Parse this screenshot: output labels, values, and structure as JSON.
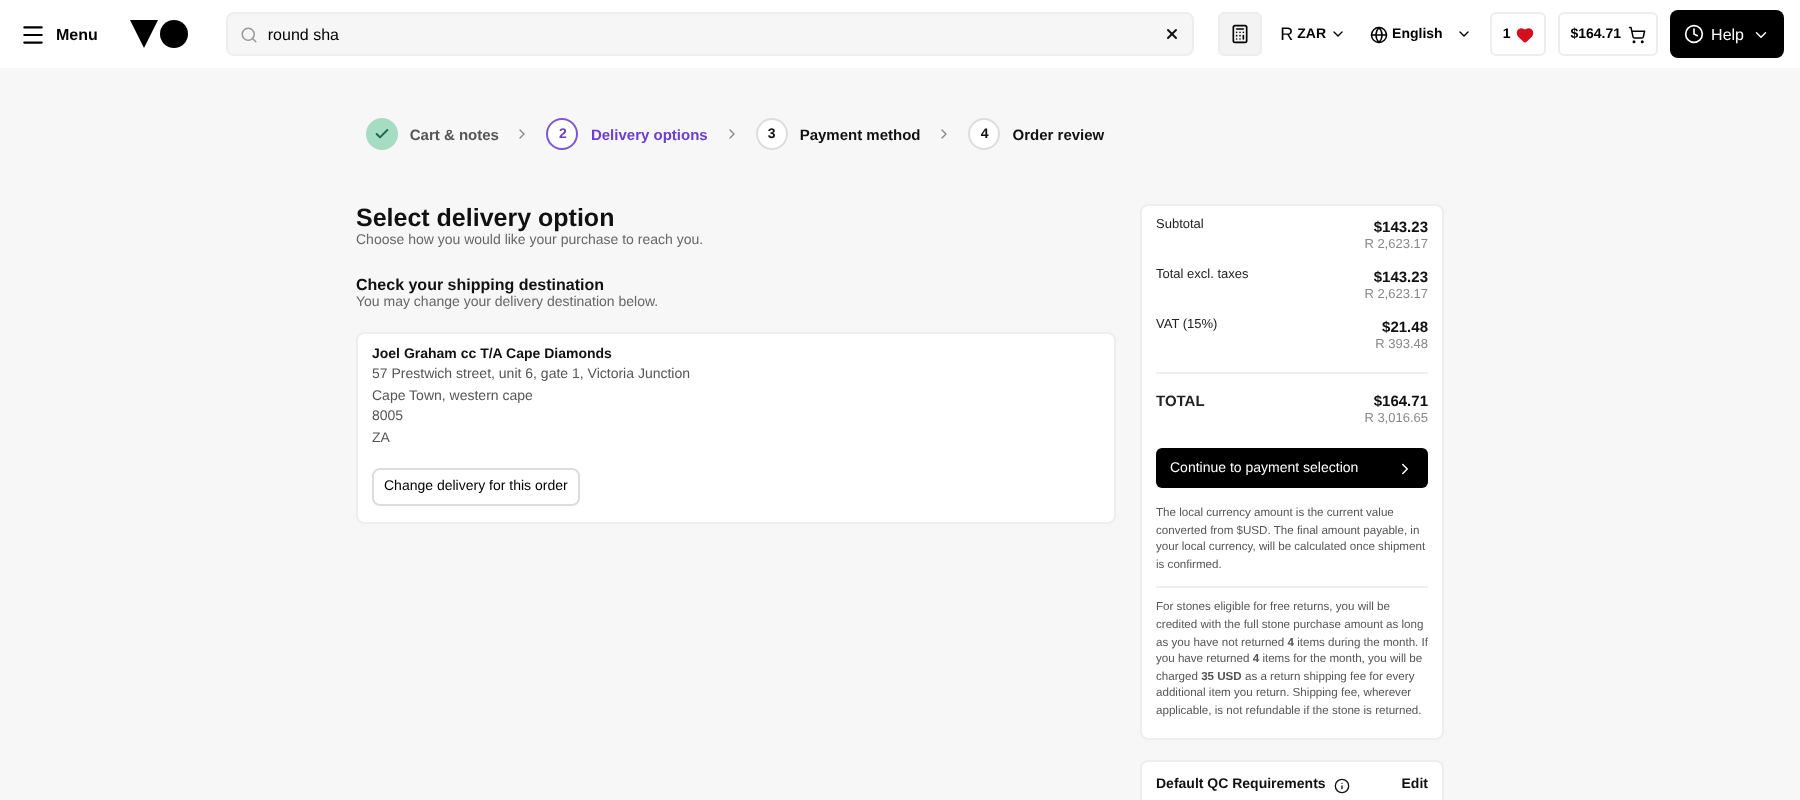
{
  "header": {
    "menu_label": "Menu",
    "search": {
      "value": "round sha"
    },
    "currency": "ZAR",
    "currency_symbol": "R",
    "language": "English",
    "wishlist_count": "1",
    "cart_total": "$164.71",
    "help_label": "Help"
  },
  "steps": [
    {
      "label": "Cart & notes",
      "completed": true,
      "selected": false
    },
    {
      "number": "2",
      "label": "Delivery options",
      "completed": false,
      "selected": true
    },
    {
      "number": "3",
      "label": "Payment method",
      "completed": false,
      "selected": false
    },
    {
      "number": "4",
      "label": "Order review",
      "completed": false,
      "selected": false
    }
  ],
  "delivery": {
    "title": "Select delivery option",
    "subtitle": "Choose how you would like your purchase to reach you.",
    "destination_title": "Check your shipping destination",
    "destination_subtitle": "You may change your delivery destination below.",
    "address": {
      "name": "Joel Graham cc T/A Cape Diamonds",
      "lines": [
        "57 Prestwich street, unit 6, gate 1, Victoria Junction",
        "Cape Town, western cape",
        "8005",
        "ZA"
      ]
    },
    "change_button": "Change delivery for this order"
  },
  "summary": {
    "rows": [
      {
        "label": "Subtotal",
        "usd": "$143.23",
        "local": "R 2,623.17",
        "kind": "line"
      },
      {
        "label": "Total excl. taxes",
        "usd": "$143.23",
        "local": "R 2,623.17",
        "kind": "line"
      },
      {
        "label": "VAT (15%)",
        "usd": "$21.48",
        "local": "R 393.48",
        "kind": "line"
      },
      {
        "label": "TOTAL",
        "usd": "$164.71",
        "local": "R 3,016.65",
        "kind": "total"
      }
    ],
    "continue_button": "Continue to payment selection",
    "notes": [
      "The local currency amount is the current value converted from $USD. The final amount payable, in your local currency, will be calculated once shipment is confirmed.",
      "For stones eligible for free returns, you will be credited with the full stone purchase amount as long as you have not returned **4** items during the month. If you have returned **4** items for the month, you will be charged **35 USD** as a return shipping fee for every additional item you return. Shipping fee, wherever applicable, is not refundable if the stone is returned."
    ]
  },
  "qc": {
    "title": "Default QC Requirements",
    "edit_label": "Edit"
  }
}
